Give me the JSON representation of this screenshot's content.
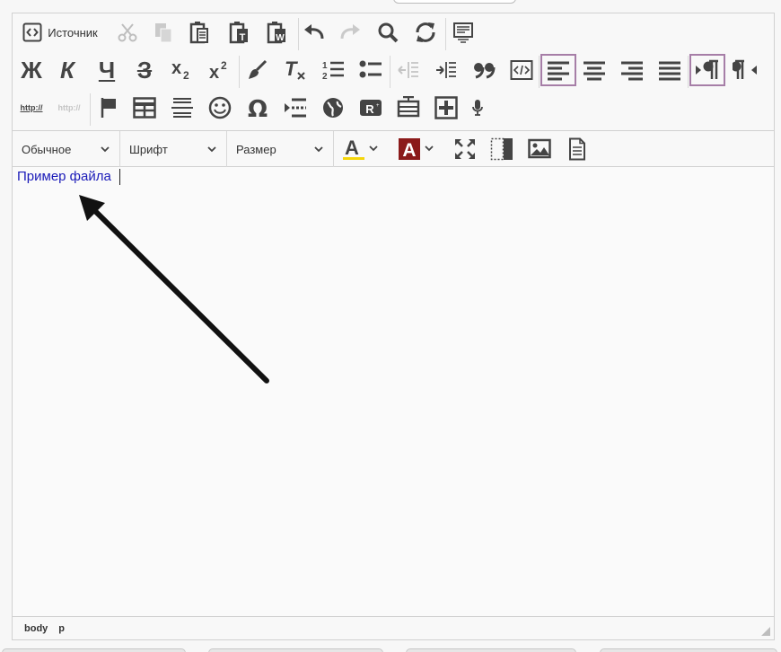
{
  "toolbar": {
    "source_label": "Источник",
    "bold_label": "Ж",
    "italic_label": "К",
    "underline_label": "Ч",
    "strike_label": "З",
    "link_label": "http://",
    "unlink_label": "http://"
  },
  "format_combo": {
    "format": "Обычное",
    "font": "Шрифт",
    "size": "Размер"
  },
  "content": {
    "paragraph_text": "Пример файла"
  },
  "statusbar": {
    "path": [
      "body",
      "p"
    ]
  },
  "colors": {
    "text_color_bar": "#f5d60a",
    "bg_color_icon": "#8b1a1a",
    "content_text": "#1a1ab8",
    "active_border": "#a67ea7"
  }
}
